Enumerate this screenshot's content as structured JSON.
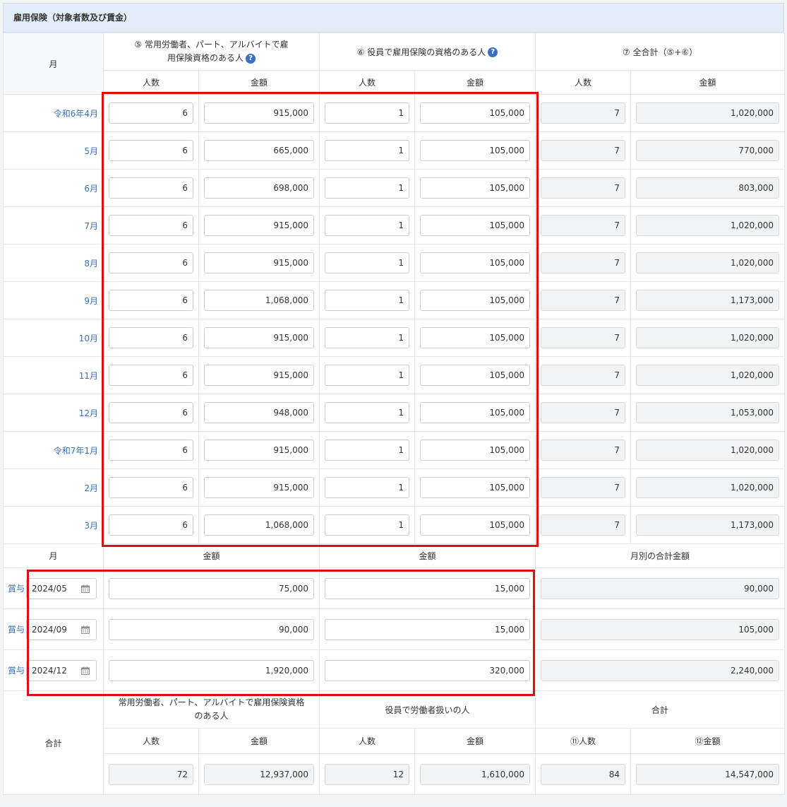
{
  "section_title": "雇用保険（対象者数及び賃金）",
  "header": {
    "month": "月",
    "group5": "⑤ 常用労働者、パート、アルバイトで雇用保険資格のある人",
    "group6": "⑥ 役員で雇用保険の資格のある人",
    "group7": "⑦ 全合計（⑤+⑥）",
    "count": "人数",
    "amount": "金額",
    "help_glyph": "?"
  },
  "months": [
    {
      "label": "令和6年4月",
      "c5": "6",
      "a5": "915,000",
      "c6": "1",
      "a6": "105,000",
      "c7": "7",
      "a7": "1,020,000"
    },
    {
      "label": "5月",
      "c5": "6",
      "a5": "665,000",
      "c6": "1",
      "a6": "105,000",
      "c7": "7",
      "a7": "770,000"
    },
    {
      "label": "6月",
      "c5": "6",
      "a5": "698,000",
      "c6": "1",
      "a6": "105,000",
      "c7": "7",
      "a7": "803,000"
    },
    {
      "label": "7月",
      "c5": "6",
      "a5": "915,000",
      "c6": "1",
      "a6": "105,000",
      "c7": "7",
      "a7": "1,020,000"
    },
    {
      "label": "8月",
      "c5": "6",
      "a5": "915,000",
      "c6": "1",
      "a6": "105,000",
      "c7": "7",
      "a7": "1,020,000"
    },
    {
      "label": "9月",
      "c5": "6",
      "a5": "1,068,000",
      "c6": "1",
      "a6": "105,000",
      "c7": "7",
      "a7": "1,173,000"
    },
    {
      "label": "10月",
      "c5": "6",
      "a5": "915,000",
      "c6": "1",
      "a6": "105,000",
      "c7": "7",
      "a7": "1,020,000"
    },
    {
      "label": "11月",
      "c5": "6",
      "a5": "915,000",
      "c6": "1",
      "a6": "105,000",
      "c7": "7",
      "a7": "1,020,000"
    },
    {
      "label": "12月",
      "c5": "6",
      "a5": "948,000",
      "c6": "1",
      "a6": "105,000",
      "c7": "7",
      "a7": "1,053,000"
    },
    {
      "label": "令和7年1月",
      "c5": "6",
      "a5": "915,000",
      "c6": "1",
      "a6": "105,000",
      "c7": "7",
      "a7": "1,020,000"
    },
    {
      "label": "2月",
      "c5": "6",
      "a5": "915,000",
      "c6": "1",
      "a6": "105,000",
      "c7": "7",
      "a7": "1,020,000"
    },
    {
      "label": "3月",
      "c5": "6",
      "a5": "1,068,000",
      "c6": "1",
      "a6": "105,000",
      "c7": "7",
      "a7": "1,173,000"
    }
  ],
  "bonus_header": {
    "month": "月",
    "amount": "金額",
    "monthly_total": "月別の合計金額"
  },
  "bonus": [
    {
      "label": "賞与",
      "date": "2024/05",
      "a5": "75,000",
      "a6": "15,000",
      "total": "90,000"
    },
    {
      "label": "賞与",
      "date": "2024/09",
      "a5": "90,000",
      "a6": "15,000",
      "total": "105,000"
    },
    {
      "label": "賞与",
      "date": "2024/12",
      "a5": "1,920,000",
      "a6": "320,000",
      "total": "2,240,000"
    }
  ],
  "totals": {
    "label": "合計",
    "group_workers": "常用労働者、パート、アルバイトで雇用保険資格のある人",
    "group_officers": "役員で労働者扱いの人",
    "group_total": "合計",
    "count": "人数",
    "amount": "金額",
    "count11": "⑪人数",
    "amount12": "⑫金額",
    "c5": "72",
    "a5": "12,937,000",
    "c6": "12",
    "a6": "1,610,000",
    "c11": "84",
    "a12": "14,547,000"
  },
  "colors": {
    "highlight": "#e00d0d",
    "link": "#3872b8",
    "help": "#3a6fc4",
    "header_bg": "#e3edf9"
  },
  "icons": [
    "help-icon",
    "calendar-icon"
  ]
}
